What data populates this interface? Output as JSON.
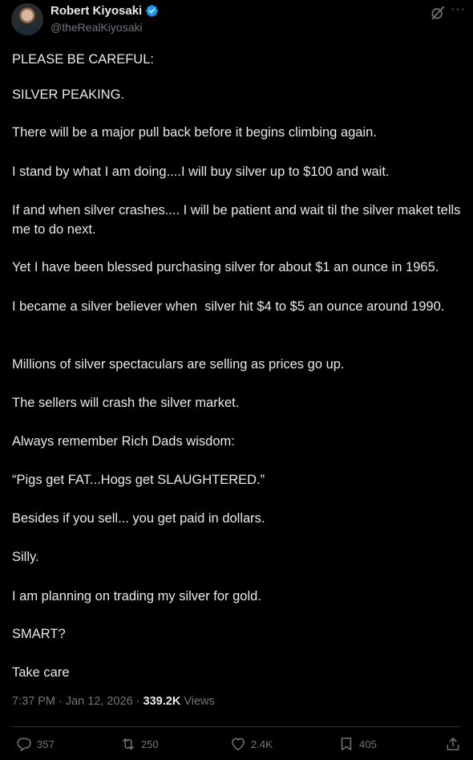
{
  "author": {
    "name": "Robert Kiyosaki",
    "handle": "@theRealKiyosaki"
  },
  "post": {
    "paragraphs": [
      "PLEASE BE CAREFUL:",
      "SILVER PEAKING.",
      "There will be a major pull back before it begins climbing again.",
      "I stand by what I am doing....I will buy silver up to $100 and wait.",
      "If and when silver crashes.... I will be patient and wait til the silver maket tells me to do next.",
      "Yet I have been blessed purchasing silver for about $1 an ounce in 1965.",
      "I became a silver believer when  silver hit $4 to $5 an ounce around 1990.",
      "Millions of silver spectaculars are selling as prices go up.",
      "The sellers will crash the silver market.",
      "Always remember Rich Dads wisdom:",
      "“Pigs get FAT...Hogs get SLAUGHTERED.”",
      "Besides if you sell... you get paid in dollars.",
      "Silly.",
      "I am planning on trading my silver for gold.",
      "SMART?",
      "Take care"
    ]
  },
  "meta": {
    "time": "7:37 PM",
    "sep1": "·",
    "date": "Jan 12, 2026",
    "sep2": "·",
    "views_count": "339.2K",
    "views_label": "Views"
  },
  "actions": {
    "replies": "357",
    "reposts": "250",
    "likes": "2.4K",
    "bookmarks": "405"
  },
  "colors": {
    "background": "#000000",
    "text": "#e7e9ea",
    "secondary": "#71767b",
    "verified": "#1d9bf0",
    "divider": "#2f3336"
  }
}
